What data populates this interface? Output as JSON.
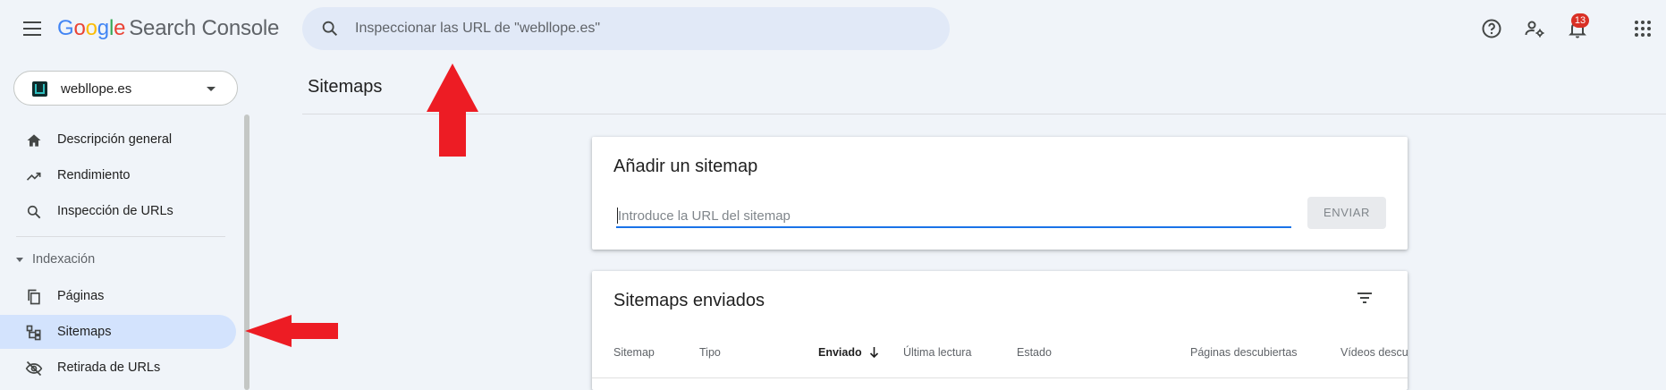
{
  "header": {
    "logo_letters": [
      {
        "char": "G",
        "color": "#4285f4"
      },
      {
        "char": "o",
        "color": "#ea4335"
      },
      {
        "char": "o",
        "color": "#fbbc05"
      },
      {
        "char": "g",
        "color": "#4285f4"
      },
      {
        "char": "l",
        "color": "#34a853"
      },
      {
        "char": "e",
        "color": "#ea4335"
      }
    ],
    "product_name": "Search Console",
    "search_placeholder": "Inspeccionar las URL de \"webllope.es\"",
    "notifications_count": "13",
    "icons": [
      "menu-icon",
      "search-icon",
      "help-icon",
      "manage-users-icon",
      "bell-icon",
      "apps-grid-icon"
    ]
  },
  "property": {
    "name": "webllope.es"
  },
  "sidebar": {
    "items": [
      {
        "label": "Descripción general",
        "icon": "home-icon"
      },
      {
        "label": "Rendimiento",
        "icon": "trending-up-icon"
      },
      {
        "label": "Inspección de URLs",
        "icon": "search-icon"
      }
    ],
    "section_label": "Indexación",
    "section_items": [
      {
        "label": "Páginas",
        "icon": "pages-icon"
      },
      {
        "label": "Sitemaps",
        "icon": "sitemap-icon",
        "active": true
      },
      {
        "label": "Retirada de URLs",
        "icon": "visibility-off-icon"
      }
    ]
  },
  "main": {
    "page_title": "Sitemaps",
    "add_card": {
      "title": "Añadir un sitemap",
      "input_placeholder": "Introduce la URL del sitemap",
      "submit_label": "ENVIAR"
    },
    "submitted_card": {
      "title": "Sitemaps enviados",
      "columns": [
        "Sitemap",
        "Tipo",
        "Enviado",
        "Última lectura",
        "Estado",
        "Páginas descubiertas",
        "Vídeos descubiertos"
      ],
      "sorted_column": "Enviado"
    }
  },
  "colors": {
    "active_nav_bg": "#d3e3fd",
    "search_bg": "#e1e9f7",
    "accent_blue": "#1a73e8",
    "annotation_red": "#ed1c24"
  }
}
